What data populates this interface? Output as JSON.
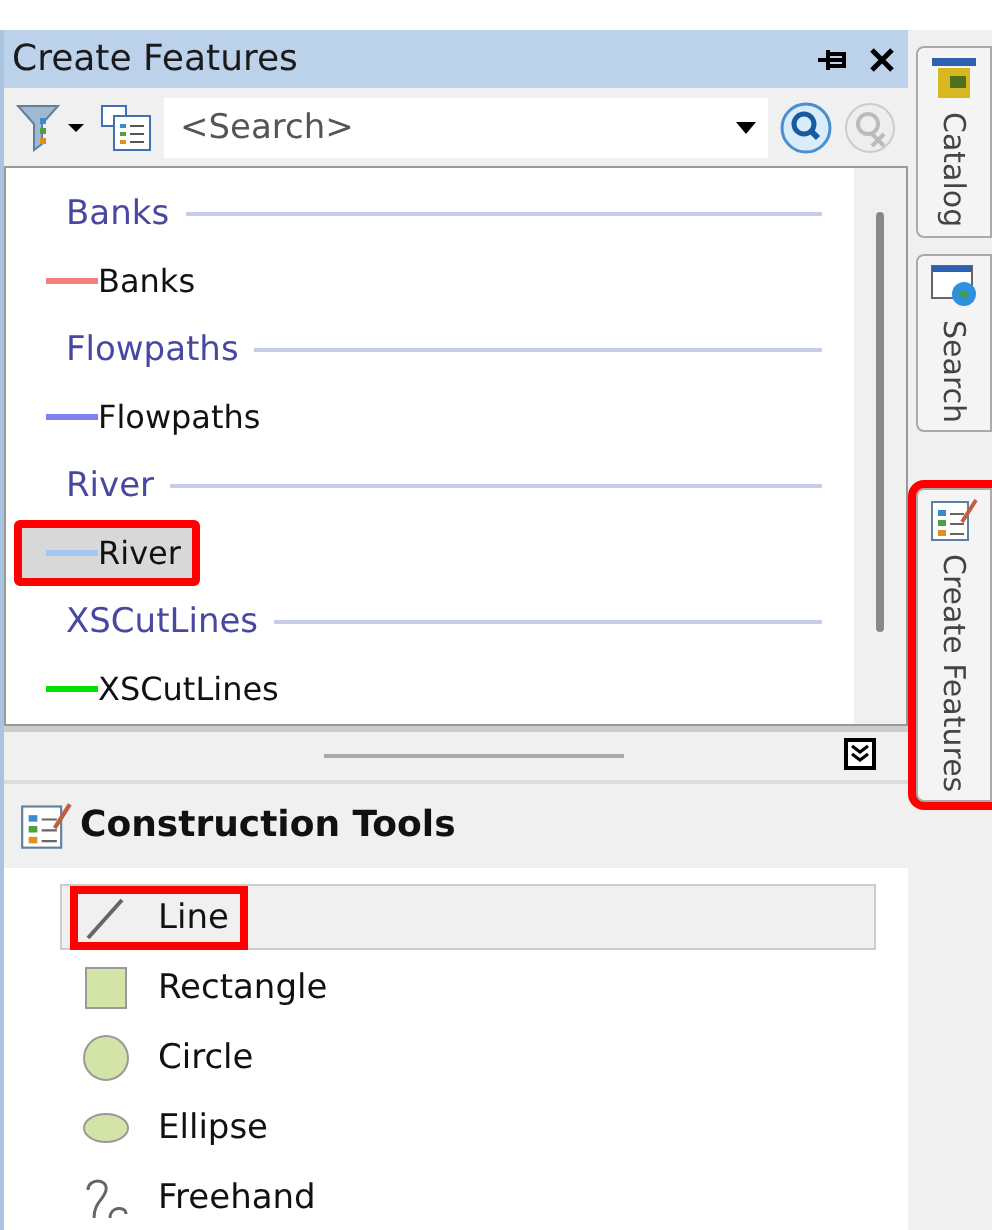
{
  "panel": {
    "title": "Create Features",
    "search": {
      "placeholder": "<Search>"
    }
  },
  "layers": [
    {
      "name": "Banks",
      "template": {
        "label": "Banks",
        "color": "#f08080",
        "selected": false,
        "highlighted": false
      }
    },
    {
      "name": "Flowpaths",
      "template": {
        "label": "Flowpaths",
        "color": "#8080f0",
        "selected": false,
        "highlighted": false
      }
    },
    {
      "name": "River",
      "template": {
        "label": "River",
        "color": "#a0c8f0",
        "selected": true,
        "highlighted": true
      }
    },
    {
      "name": "XSCutLines",
      "template": {
        "label": "XSCutLines",
        "color": "#00e000",
        "selected": false,
        "highlighted": false
      }
    }
  ],
  "construction_tools": {
    "title": "Construction Tools",
    "tools": [
      {
        "kind": "line",
        "label": "Line",
        "selected": true,
        "highlighted": true
      },
      {
        "kind": "rectangle",
        "label": "Rectangle",
        "selected": false,
        "highlighted": false
      },
      {
        "kind": "circle",
        "label": "Circle",
        "selected": false,
        "highlighted": false
      },
      {
        "kind": "ellipse",
        "label": "Ellipse",
        "selected": false,
        "highlighted": false
      },
      {
        "kind": "freehand",
        "label": "Freehand",
        "selected": false,
        "highlighted": false
      }
    ]
  },
  "side_tabs": [
    {
      "kind": "catalog",
      "label": "Catalog",
      "highlighted": false
    },
    {
      "kind": "search",
      "label": "Search",
      "highlighted": false
    },
    {
      "kind": "create",
      "label": "Create Features",
      "highlighted": true
    }
  ]
}
